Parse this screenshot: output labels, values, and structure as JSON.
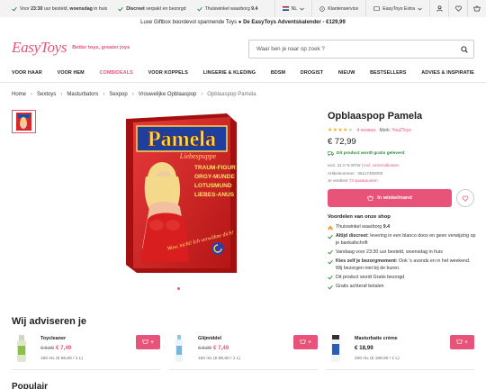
{
  "topbar": {
    "usp": [
      {
        "pre": "Voor ",
        "bold": "23:30",
        "post": " uur besteld, ",
        "bold2": "woensdag",
        "post2": " in huis"
      },
      {
        "pre": "",
        "bold": "Discreet",
        "post": " verpakt en bezorgd",
        "bold2": "",
        "post2": ""
      },
      {
        "pre": "Thuiswinkel waarborg ",
        "bold": "9.4",
        "post": "",
        "bold2": "",
        "post2": ""
      }
    ],
    "country": "NL",
    "service": "Klantenservice",
    "extra": "EasyToys Extra"
  },
  "promo": {
    "text": "Luxe Giftbox boordevol spannende Toys",
    "bold": "De EasyToys Adventskalender - €129,99"
  },
  "logo": {
    "brand": "EasyToys",
    "tagline": "Better toys, greater joys"
  },
  "search": {
    "placeholder": "Waar ben je naar op zoek ?"
  },
  "nav": [
    "VOOR HAAR",
    "VOOR HEM",
    "COMBIDEALS",
    "VOOR KOPPELS",
    "LINGERIE & KLEDING",
    "BDSM",
    "DROGIST",
    "NIEUW",
    "BESTSELLERS",
    "ADVIES & INSPIRATIE"
  ],
  "breadcrumbs": [
    "Home",
    "Sextoys",
    "Masturbators",
    "Sexpop",
    "Vrouwelijke Opblaaspop",
    "Opblaaspop Pamela"
  ],
  "product": {
    "title": "Opblaaspop Pamela",
    "rating": 4,
    "reviews": "4 reviews",
    "brand_label": "Merk:",
    "brand": "You2Toys",
    "price": "€ 72,99",
    "free_shipping": "Dit product wordt gratis geleverd",
    "vat_pre": "excl. 21.0 % BTW | ",
    "vat_link": "incl. verzendkosten",
    "article": "Artikelnummer : 05117490000",
    "points_pre": "Je verdient ",
    "points_link": "73 spaarpunten",
    "cart_label": "In winkelmand",
    "box_lines": [
      "Pamela",
      "Liebespuppe",
      "TRAUM-FIGUR",
      "ORGY-MUNDE",
      "LOTUSMUND",
      "LIEBES-ANUS"
    ],
    "box_script": "Wow, nicht! Ich verwöhne dich!"
  },
  "advantages": {
    "title": "Voordelen van onze shop",
    "items": [
      {
        "bold": "",
        "text": "Thuiswinkel waarborg ",
        "tail_bold": "9.4"
      },
      {
        "bold": "Altijd discreet:",
        "text": " levering in een blanco doos en geen verwijzing op je bankafschrift",
        "tail_bold": ""
      },
      {
        "bold": "",
        "text": "Vandaag voor 23:30 uur besteld, woensdag in huis",
        "tail_bold": ""
      },
      {
        "bold": "Kies zelf je bezorgmoment:",
        "text": " Ook 's avonds en in het weekend. Wij bezorgen niet bij de buren.",
        "tail_bold": ""
      },
      {
        "bold": "",
        "text": "Dit product wordt Gratis bezorgd",
        "tail_bold": ""
      },
      {
        "bold": "",
        "text": "Gratis achteraf betalen",
        "tail_bold": ""
      }
    ]
  },
  "recommend": {
    "title": "Wij adviseren je",
    "items": [
      {
        "name": "Toycleaner",
        "old": "€ 9,99",
        "new": "€ 7,49",
        "vol": "150 mL (€ 66,60 / 1 L)"
      },
      {
        "name": "Glijmiddel",
        "old": "€ 9,99",
        "new": "€ 7,49",
        "vol": "150 mL (€ 66,60 / 1 L)"
      },
      {
        "name": "Masturbatie crème",
        "old": "",
        "new": "€ 18,99",
        "vol": "100 mL (€ 189,90 / 1 L)"
      }
    ]
  },
  "popular": {
    "title": "Populair"
  },
  "colors": {
    "accent": "#e8537a",
    "green": "#2e8b3a",
    "star": "#f2b01e"
  }
}
